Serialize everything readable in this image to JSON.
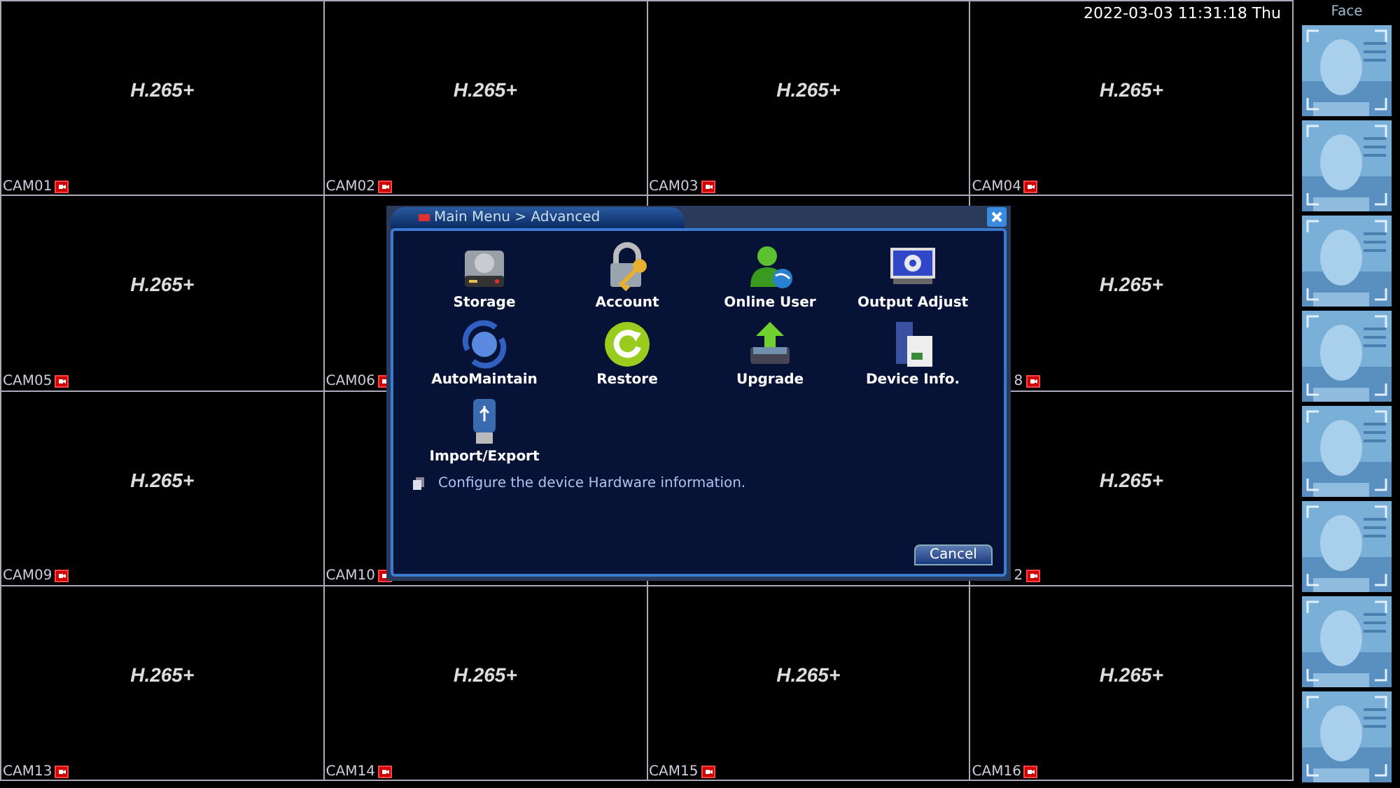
{
  "timestamp": "2022-03-03 11:31:18 Thu",
  "cameras": [
    {
      "kind": "full",
      "codec": "H.265+",
      "label": "CAM01"
    },
    {
      "kind": "full",
      "codec": "H.265+",
      "label": "CAM02"
    },
    {
      "kind": "full",
      "codec": "H.265+",
      "label": "CAM03"
    },
    {
      "kind": "full",
      "codec": "H.265+",
      "label": "CAM04"
    },
    {
      "kind": "full",
      "codec": "H.265+",
      "label": "CAM05"
    },
    {
      "kind": "label_only",
      "label": "CAM06"
    },
    {
      "kind": "hidden"
    },
    {
      "kind": "cut_left",
      "codec": "H.265+",
      "label": "8"
    },
    {
      "kind": "full",
      "codec": "H.265+",
      "label": "CAM09"
    },
    {
      "kind": "label_only",
      "label": "CAM10"
    },
    {
      "kind": "hidden"
    },
    {
      "kind": "cut_left",
      "codec": "H.265+",
      "label": "2"
    },
    {
      "kind": "full",
      "codec": "H.265+",
      "label": "CAM13"
    },
    {
      "kind": "full",
      "codec": "H.265+",
      "label": "CAM14"
    },
    {
      "kind": "full",
      "codec": "H.265+",
      "label": "CAM15"
    },
    {
      "kind": "full",
      "codec": "H.265+",
      "label": "CAM16"
    }
  ],
  "face_panel": {
    "title": "Face"
  },
  "dialog": {
    "title": "Main Menu > Advanced",
    "items": [
      {
        "kind": "storage",
        "label": "Storage"
      },
      {
        "kind": "account",
        "label": "Account"
      },
      {
        "kind": "online_user",
        "label": "Online User"
      },
      {
        "kind": "output",
        "label": "Output Adjust"
      },
      {
        "kind": "maintain",
        "label": "AutoMaintain"
      },
      {
        "kind": "restore",
        "label": "Restore"
      },
      {
        "kind": "upgrade",
        "label": "Upgrade"
      },
      {
        "kind": "device_info",
        "label": "Device Info."
      },
      {
        "kind": "usb",
        "label": "Import/Export"
      }
    ],
    "description": "Configure the device Hardware information.",
    "cancel": "Cancel"
  }
}
